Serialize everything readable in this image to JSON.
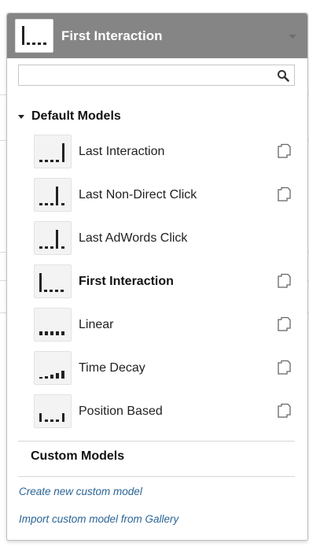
{
  "header": {
    "title": "First Interaction"
  },
  "search": {
    "placeholder": "",
    "value": ""
  },
  "default_models": {
    "title": "Default Models",
    "items": [
      {
        "label": "Last Interaction",
        "icon": "last-interaction-icon",
        "copyable": true,
        "selected": false
      },
      {
        "label": "Last Non-Direct Click",
        "icon": "last-non-direct-click-icon",
        "copyable": true,
        "selected": false
      },
      {
        "label": "Last AdWords Click",
        "icon": "last-adwords-click-icon",
        "copyable": false,
        "selected": false
      },
      {
        "label": "First Interaction",
        "icon": "first-interaction-icon",
        "copyable": true,
        "selected": true
      },
      {
        "label": "Linear",
        "icon": "linear-icon",
        "copyable": true,
        "selected": false
      },
      {
        "label": "Time Decay",
        "icon": "time-decay-icon",
        "copyable": true,
        "selected": false
      },
      {
        "label": "Position Based",
        "icon": "position-based-icon",
        "copyable": true,
        "selected": false
      }
    ]
  },
  "custom_models": {
    "title": "Custom Models",
    "create_link": "Create new custom model",
    "import_link": "Import custom model from Gallery"
  },
  "colors": {
    "header_bg": "#858585",
    "link": "#2a6496",
    "bar": "#222222"
  }
}
